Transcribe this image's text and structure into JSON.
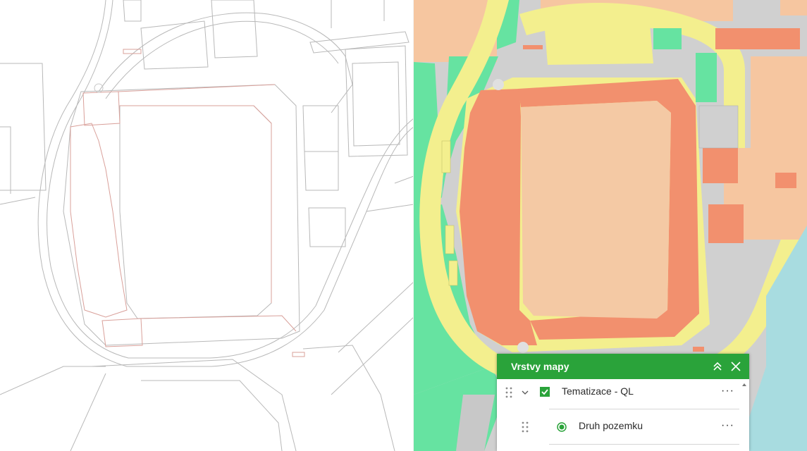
{
  "panel": {
    "title": "Vrstvy mapy",
    "collapse_icon": "double-chevron-up-icon",
    "close_icon": "close-icon",
    "layers": [
      {
        "label": "Tematizace - QL",
        "checked": true,
        "expanded": true,
        "more_label": "···"
      },
      {
        "label": "Druh pozemku",
        "selected": true,
        "more_label": "···"
      }
    ]
  },
  "colors": {
    "header_green": "#2aa33a",
    "stand_orange": "#f2906e",
    "pitch_peach": "#f4c9a4",
    "path_yellow": "#f3ef8e",
    "green_area": "#66e3a1",
    "built_gray": "#d0d0d0",
    "cadastral_line": "#b0b0b0",
    "building_line": "#d9a09a"
  }
}
